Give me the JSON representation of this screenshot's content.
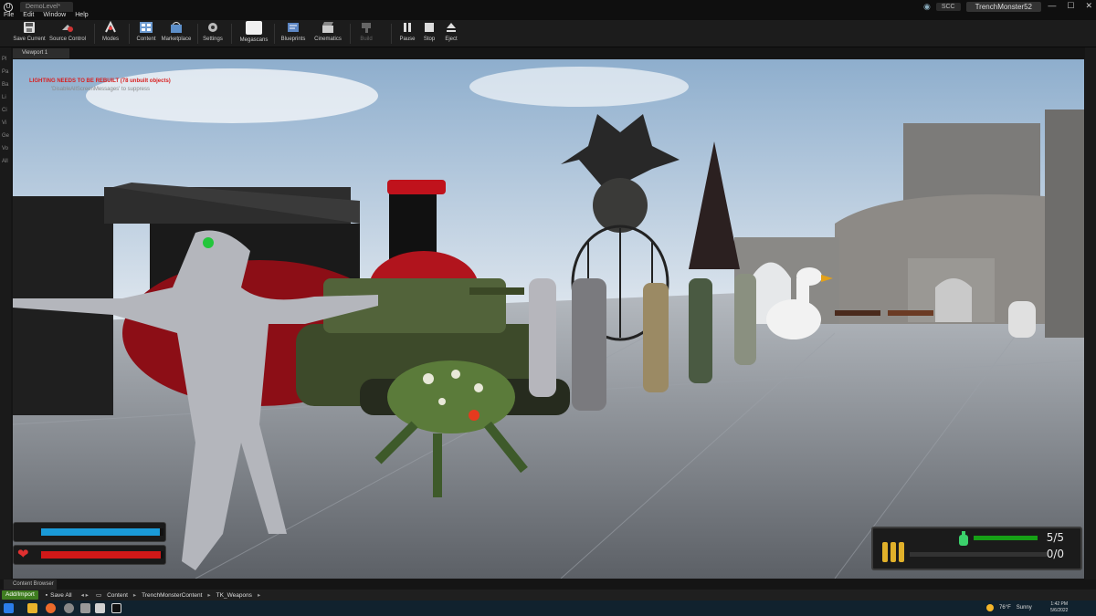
{
  "titlebar": {
    "doc_tab": "DemoLevel*",
    "menu": [
      "File",
      "Edit",
      "Window",
      "Help"
    ],
    "source_control": "SCC",
    "project_name": "TrenchMonster52",
    "window_controls": [
      "—",
      "☐",
      "✕"
    ]
  },
  "toolbar": {
    "buttons": [
      {
        "label": "Save Current",
        "icon": "save-icon"
      },
      {
        "label": "Source Control",
        "icon": "source-control-icon"
      },
      {
        "label": "Modes",
        "icon": "modes-icon"
      },
      {
        "label": "Content",
        "icon": "content-icon"
      },
      {
        "label": "Marketplace",
        "icon": "marketplace-icon"
      },
      {
        "label": "Settings",
        "icon": "settings-icon"
      },
      {
        "label": "Megascans",
        "icon": "megascans-icon"
      },
      {
        "label": "Blueprints",
        "icon": "blueprints-icon"
      },
      {
        "label": "Cinematics",
        "icon": "cinematics-icon"
      },
      {
        "label": "Build",
        "icon": "build-icon"
      },
      {
        "label": "Pause",
        "icon": "pause-icon"
      },
      {
        "label": "Stop",
        "icon": "stop-icon"
      },
      {
        "label": "Eject",
        "icon": "eject-icon"
      }
    ]
  },
  "left_panel": {
    "labels": [
      "Pl",
      "Pa",
      "Ba",
      "Li",
      "Ci",
      "Vi",
      "Ge",
      "Vo",
      "All"
    ]
  },
  "viewport": {
    "tab": "Viewport 1",
    "lighting_warning": "LIGHTING NEEDS TO BE REBUILT (78 unbuilt objects)",
    "lighting_hint": "'DisableAllScreenMessages' to suppress"
  },
  "hud": {
    "stamina_fraction": 0.97,
    "health_fraction": 0.98,
    "stamina_color": "#1a9ad8",
    "health_color": "#d01818",
    "ammo_primary": "5/5",
    "ammo_secondary": "0/0",
    "grenade_fraction": 1.0,
    "grenade_color": "#16a016"
  },
  "content_browser": {
    "tab": "Content Browser",
    "add_import": "Add/Import",
    "save_all": "Save All",
    "path": [
      "Content",
      "TrenchMonsterContent",
      "TK_Weapons"
    ]
  },
  "taskbar": {
    "weather_temp": "76°F",
    "weather_text": "Sunny",
    "time": "1:42 PM",
    "date": "5/6/2022"
  }
}
